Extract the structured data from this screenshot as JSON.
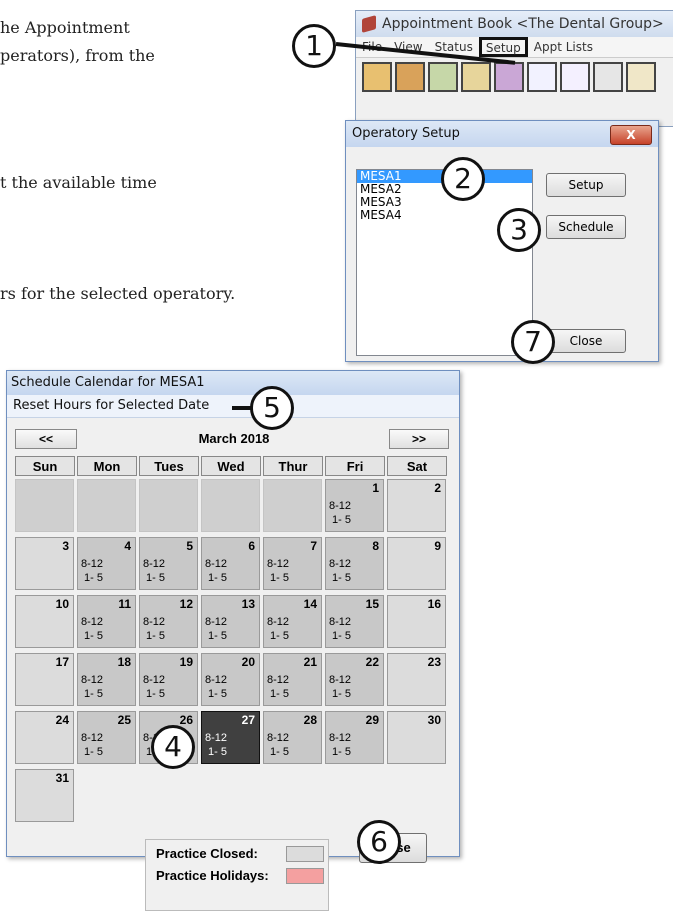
{
  "document": {
    "line1": "he Appointment",
    "line2": "perators), from the",
    "line3": "t the available time",
    "line4": "rs for the selected operatory."
  },
  "appt_window": {
    "title": "Appointment Book <The Dental Group>",
    "menu": [
      "File",
      "View",
      "Status",
      "Setup",
      "Appt Lists"
    ]
  },
  "operatory_setup": {
    "title": "Operatory Setup",
    "close_x": "X",
    "operatories": [
      "MESA1",
      "MESA2",
      "MESA3",
      "MESA4"
    ],
    "selected": "MESA1",
    "setup_button": "Setup",
    "schedule_button": "Schedule",
    "close_button": "Close"
  },
  "schedule_calendar": {
    "title": "Schedule Calendar for MESA1",
    "menu_item": "Reset Hours for Selected Date",
    "prev": "<<",
    "next": ">>",
    "month": "March 2018",
    "days": [
      "Sun",
      "Mon",
      "Tues",
      "Wed",
      "Thur",
      "Fri",
      "Sat"
    ],
    "hours_morning": "8-12",
    "hours_afternoon": "1- 5",
    "selected_date": 27,
    "legend_closed": "Practice Closed:",
    "legend_holidays": "Practice Holidays:",
    "closed_color": "#dcdcdc",
    "holiday_color": "#f4a0a0",
    "close_button": "Close"
  },
  "callouts": [
    "1",
    "2",
    "3",
    "4",
    "5",
    "6",
    "7"
  ]
}
